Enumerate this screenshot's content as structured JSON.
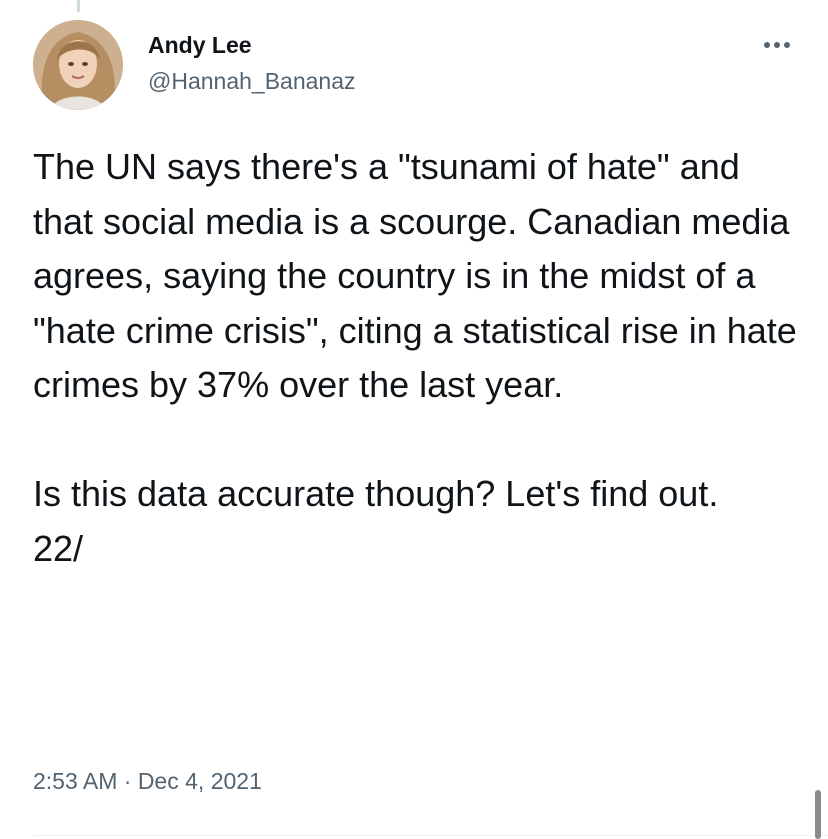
{
  "tweet": {
    "author": {
      "display_name": "Andy Lee",
      "handle": "@Hannah_Bananaz",
      "avatar_icon": "profile-photo"
    },
    "more_icon": "more-options-icon",
    "text": "The UN says there's a \"tsunami of hate\" and that social media is a scourge. Canadian media agrees, saying the country is in the midst of a \"hate crime crisis\", citing a statistical rise in hate crimes by 37% over the last year.\n\nIs this data accurate though? Let's find out.\n22/",
    "timestamp": "2:53 AM · Dec 4, 2021"
  },
  "colors": {
    "primary_text": "#0f1419",
    "secondary_text": "#536471",
    "divider": "#eff3f4"
  }
}
